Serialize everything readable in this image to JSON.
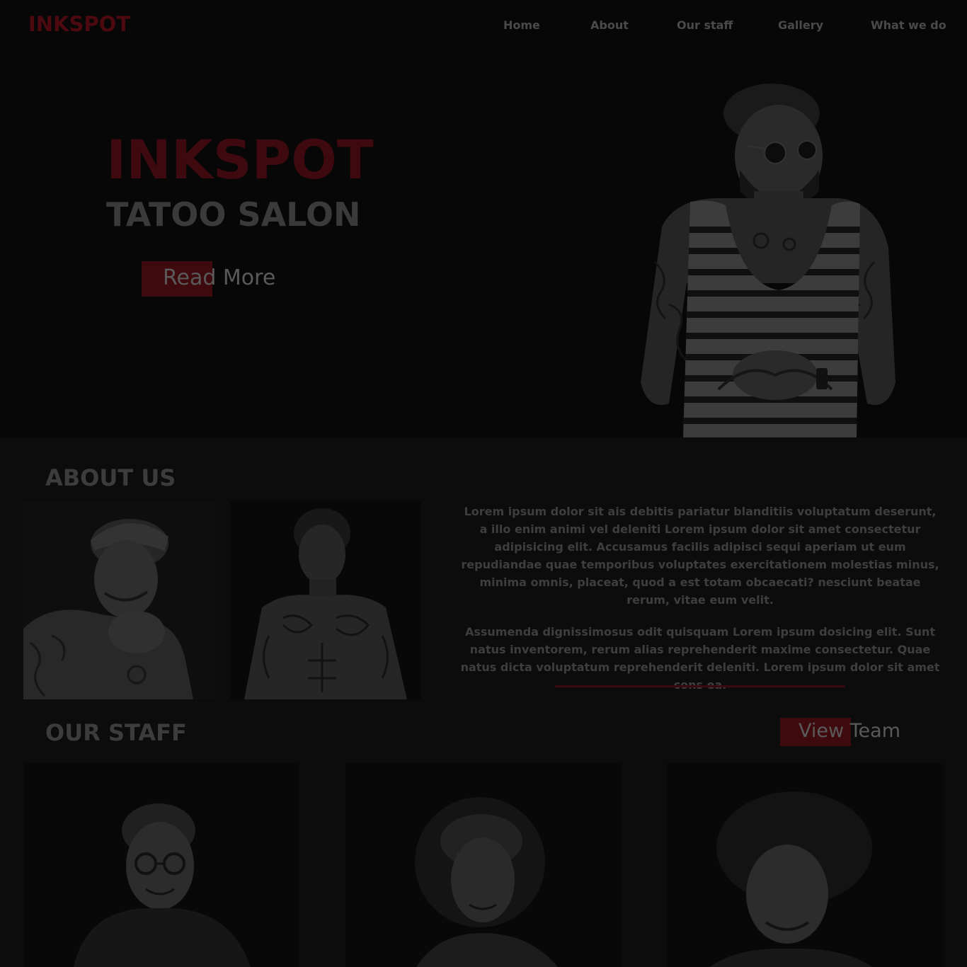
{
  "brand": {
    "logo": "INKSPOT",
    "accent": "#8b0f1a"
  },
  "nav": {
    "items": [
      {
        "label": "Home"
      },
      {
        "label": "About"
      },
      {
        "label": "Our staff"
      },
      {
        "label": "Gallery"
      },
      {
        "label": "What we do"
      }
    ]
  },
  "hero": {
    "title": "INKSPOT",
    "subtitle": "TATOO SALON",
    "button_label": "Read More"
  },
  "about": {
    "title": "ABOUT US",
    "paragraphs": [
      "Lorem ipsum dolor sit ais debitis pariatur blanditiis voluptatum deserunt, a illo enim animi vel deleniti Lorem ipsum dolor sit amet consectetur adipisicing elit. Accusamus facilis adipisci sequi aperiam ut eum repudiandae quae temporibus voluptates exercitationem molestias minus, minima omnis, placeat, quod a est totam obcaecati? nesciunt beatae rerum, vitae eum velit.",
      "Assumenda dignissimosus odit quisquam Lorem ipsum dosicing elit. Sunt natus inventorem, rerum alias reprehenderit maxime consectetur. Quae natus dicta voluptatum reprehenderit deleniti. Lorem ipsum dolor sit amet cons ea."
    ]
  },
  "staff": {
    "title": "OUR STAFF",
    "button_label": "View Team"
  }
}
